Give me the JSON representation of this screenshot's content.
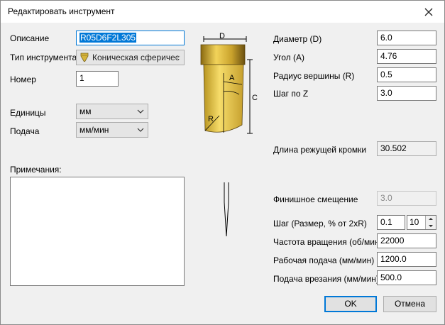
{
  "window": {
    "title": "Редактировать инструмент"
  },
  "left": {
    "description_label": "Описание",
    "description_value": "R05D6F2L305",
    "tool_type_label": "Тип инструмента",
    "tool_type_value": "Коническая сферичес",
    "number_label": "Номер",
    "number_value": "1",
    "units_label": "Единицы",
    "units_value": "мм",
    "feed_label": "Подача",
    "feed_value": "мм/мин",
    "notes_label": "Примечания:",
    "notes_value": ""
  },
  "diagram": {
    "d": "D",
    "a": "A",
    "c": "C",
    "r": "R"
  },
  "right": {
    "diameter_label": "Диаметр (D)",
    "diameter_value": "6.0",
    "angle_label": "Угол (A)",
    "angle_value": "4.76",
    "tip_radius_label": "Радиус вершины (R)",
    "tip_radius_value": "0.5",
    "step_z_label": "Шаг по Z",
    "step_z_value": "3.0",
    "cutting_length_label": "Длина режущей кромки",
    "cutting_length_value": "30.502",
    "finish_offset_label": "Финишное смещение",
    "finish_offset_value": "3.0",
    "stepover_label": "Шаг (Размер, % от 2xR)",
    "stepover_value": "0.1",
    "stepover_percent": "10",
    "spindle_label": "Частота вращения (об/мин)",
    "spindle_value": "22000",
    "work_feed_label": "Рабочая подача (мм/мин)",
    "work_feed_value": "1200.0",
    "plunge_label": "Подача врезания (мм/мин)",
    "plunge_value": "500.0"
  },
  "buttons": {
    "ok": "OK",
    "cancel": "Отмена"
  },
  "colors": {
    "accent": "#0078d7",
    "tool_gold": "#d6b43a"
  },
  "icons": {
    "close": "close-icon",
    "chevron": "chevron-down-icon",
    "tool": "tapered-ball-tool-icon"
  }
}
